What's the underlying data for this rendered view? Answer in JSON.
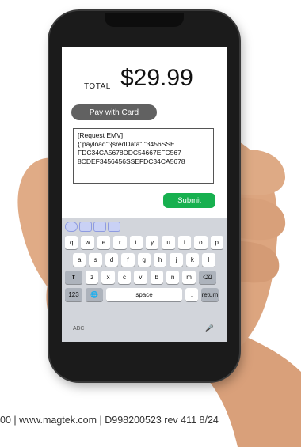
{
  "total": {
    "label": "TOTAL",
    "amount": "$29.99"
  },
  "pay_button": {
    "label": "Pay with Card"
  },
  "request": {
    "lines": [
      "[Request EMV]",
      "{\"payload\":{sredData\":\"3456SSE",
      "FDC34CA5678DDC54667EFC567",
      "8CDEF3456456SSEFDC34CA5678"
    ]
  },
  "submit_button": {
    "label": "Submit"
  },
  "keyboard": {
    "row1": [
      "q",
      "w",
      "e",
      "r",
      "t",
      "y",
      "u",
      "i",
      "o",
      "p"
    ],
    "row2": [
      "a",
      "s",
      "d",
      "f",
      "g",
      "h",
      "j",
      "k",
      "l"
    ],
    "row3": [
      "z",
      "x",
      "c",
      "v",
      "b",
      "n",
      "m"
    ],
    "numbers_key": "123",
    "space_key": "space",
    "period_key": ".",
    "return_key": "return",
    "abc_label": "ABC"
  },
  "footer": {
    "text": "00 | www.magtek.com | D998200523  rev 411  8/24"
  },
  "colors": {
    "accent_green": "#17b04f",
    "pay_gray": "#616161"
  }
}
